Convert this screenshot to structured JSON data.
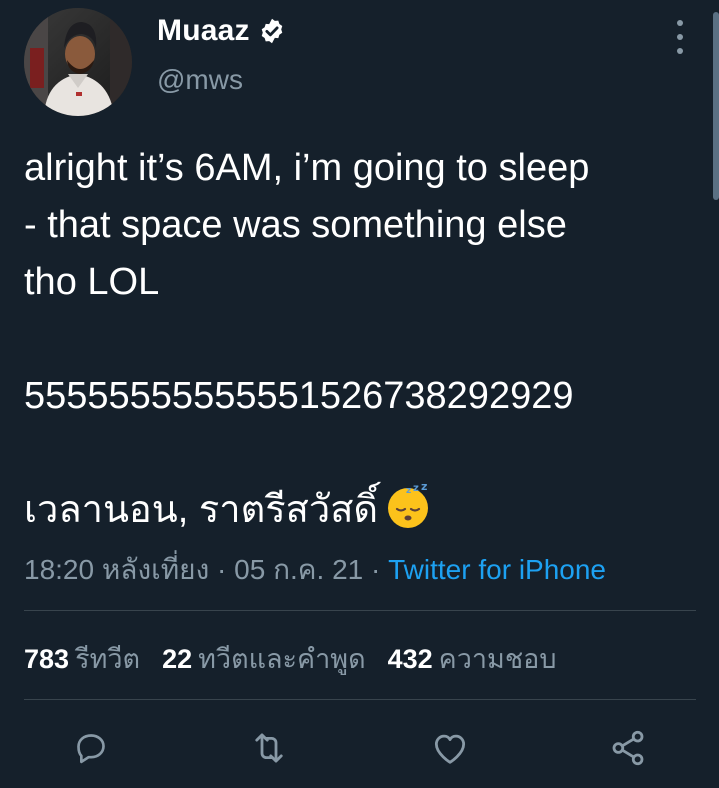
{
  "user": {
    "display_name": "Muaaz",
    "handle": "@mws",
    "verified": true
  },
  "tweet": {
    "lines": [
      "alright it’s 6AM, i’m going to sleep",
      "- that space was something else",
      "tho LOL",
      "",
      "55555555555551526738292929",
      "",
      "เวลานอน, ราตรีสวัสดิ์"
    ],
    "emoji": "sleeping-face-emoji"
  },
  "meta": {
    "time": "18:20 หลังเที่ยง",
    "separator": "·",
    "date": "05 ก.ค. 21",
    "source": "Twitter for iPhone"
  },
  "stats": {
    "retweets_count": "783",
    "retweets_label": "รีทวีต",
    "quotes_count": "22",
    "quotes_label": "ทวีตและคำพูด",
    "likes_count": "432",
    "likes_label": "ความชอบ"
  },
  "actions": [
    "reply-icon",
    "retweet-icon",
    "like-icon",
    "share-icon"
  ],
  "colors": {
    "background": "#15202b",
    "text": "#ffffff",
    "secondary": "#8899a6",
    "accent": "#1da1f2",
    "divider": "#38444d"
  }
}
